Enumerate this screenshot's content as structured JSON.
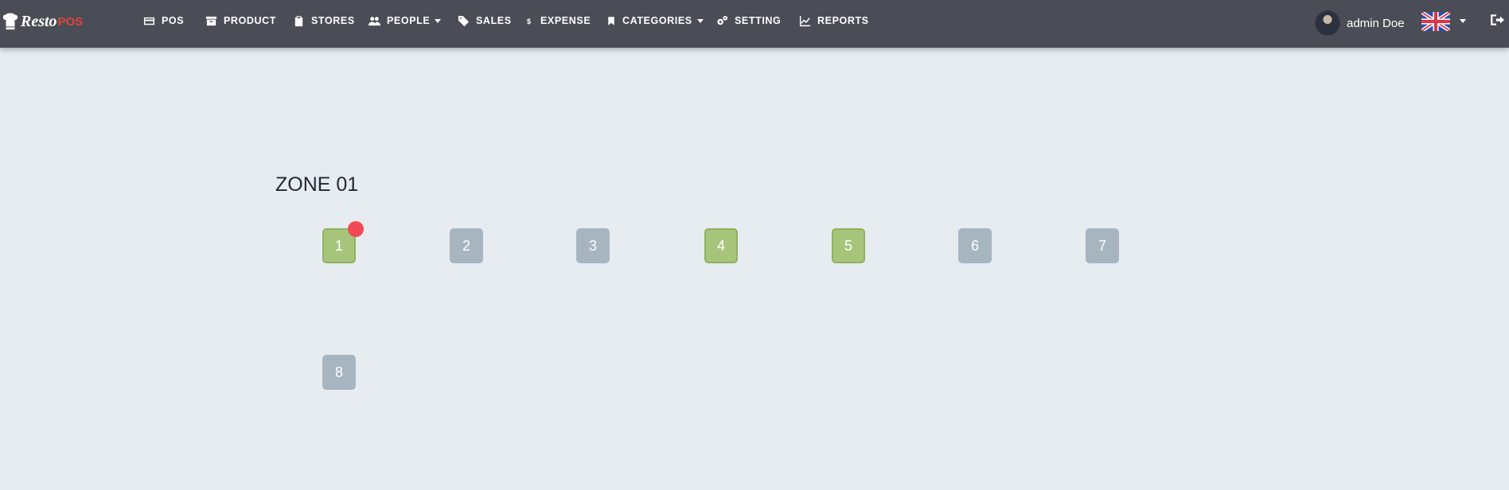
{
  "app": {
    "brand_first": "Resto",
    "brand_second": "POS",
    "brand_color": "#e0453c",
    "navbar_color": "#4a4d55"
  },
  "nav": {
    "items": [
      {
        "label": "POS",
        "icon": "credit-card-icon"
      },
      {
        "label": "PRODUCT",
        "icon": "archive-box-icon"
      },
      {
        "label": "STORES",
        "icon": "clipboard-icon"
      },
      {
        "label": "PEOPLE",
        "icon": "users-icon",
        "dropdown": true
      },
      {
        "label": "SALES",
        "icon": "tag-icon"
      },
      {
        "label": "EXPENSE",
        "icon": "dollar-icon"
      },
      {
        "label": "CATEGORIES",
        "icon": "bookmark-icon",
        "dropdown": true
      },
      {
        "label": "SETTING",
        "icon": "gears-icon"
      },
      {
        "label": "REPORTS",
        "icon": "line-chart-icon"
      }
    ]
  },
  "user": {
    "name": "admin Doe",
    "language_flag": "uk-flag-icon"
  },
  "zone": {
    "title": "ZONE 01",
    "tables": [
      {
        "number": "1",
        "status": "busy",
        "notification": true
      },
      {
        "number": "2",
        "status": "free"
      },
      {
        "number": "3",
        "status": "free"
      },
      {
        "number": "4",
        "status": "busy"
      },
      {
        "number": "5",
        "status": "busy"
      },
      {
        "number": "6",
        "status": "free"
      },
      {
        "number": "7",
        "status": "free"
      },
      {
        "number": "8",
        "status": "free"
      }
    ],
    "colors": {
      "free": "#a7b5c1",
      "busy": "#a6c57b",
      "notification": "#f04a55"
    }
  }
}
